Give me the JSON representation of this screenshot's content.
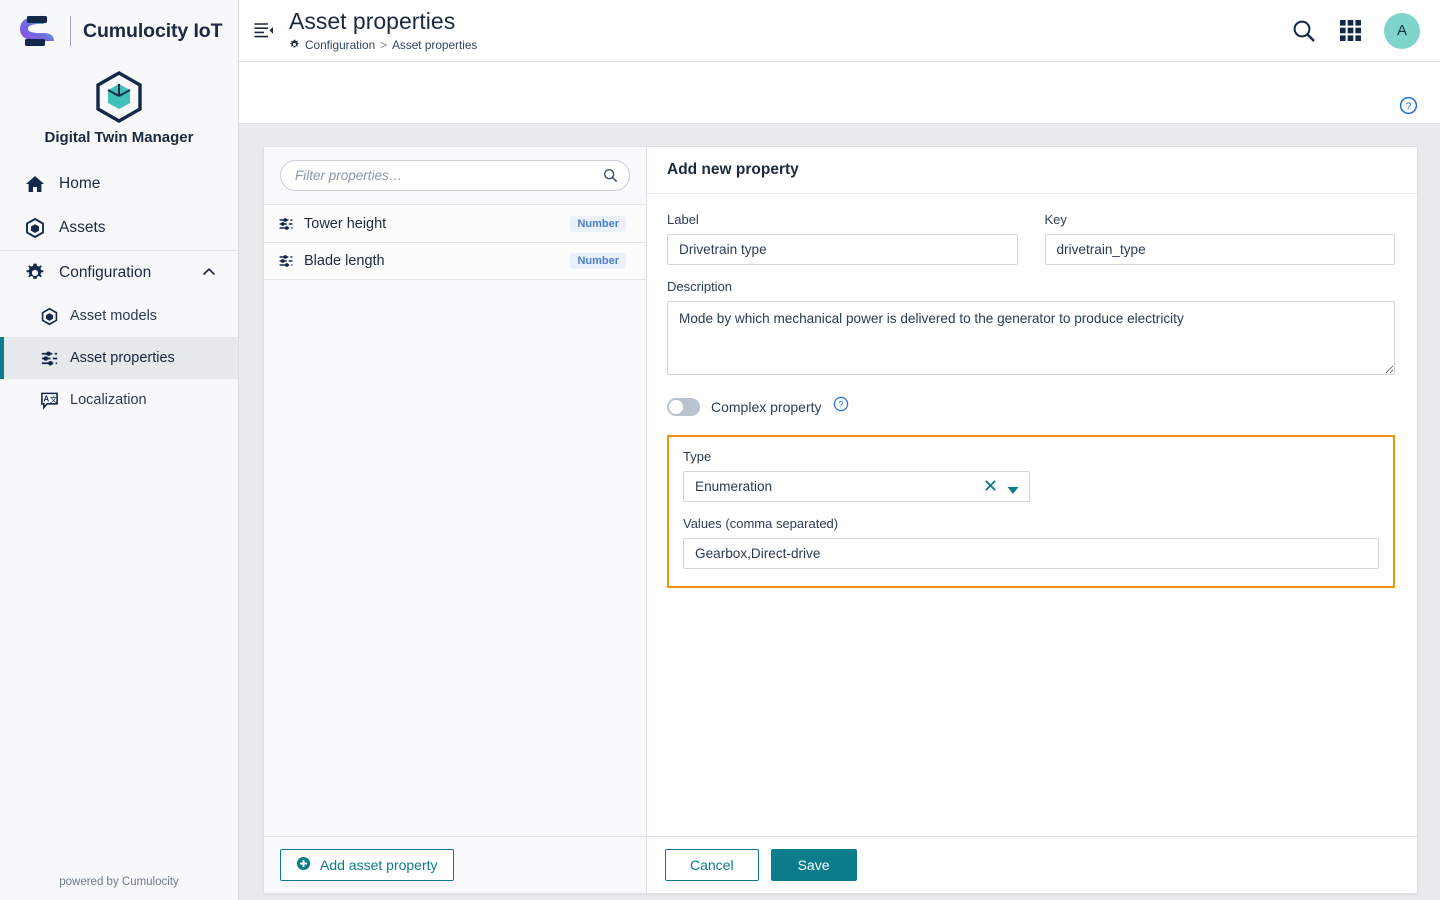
{
  "sidebar": {
    "brand_name": "Cumulocity IoT",
    "brand_logo_icon": "cumulocity-s-logo",
    "app_name": "Digital Twin Manager",
    "app_icon": "cube-hexagon-icon",
    "items": [
      {
        "label": "Home",
        "icon": "home-icon"
      },
      {
        "label": "Assets",
        "icon": "cube-icon"
      },
      {
        "label": "Configuration",
        "icon": "gear-icon",
        "chevron": "chevron-up-icon",
        "expanded": true
      }
    ],
    "sub_items": [
      {
        "label": "Asset models",
        "icon": "cube-icon",
        "active": false
      },
      {
        "label": "Asset properties",
        "icon": "sliders-icon",
        "active": true
      },
      {
        "label": "Localization",
        "icon": "translate-icon",
        "active": false
      }
    ],
    "footer_text": "powered by Cumulocity"
  },
  "topbar": {
    "collapse_icon": "collapse-sidebar-icon",
    "title": "Asset properties",
    "breadcrumb": {
      "icon": "gear-icon",
      "parent": "Configuration",
      "separator": ">",
      "current": "Asset properties"
    },
    "search_icon": "search-icon",
    "apps_icon": "app-grid-icon",
    "avatar_initial": "A",
    "avatar_color": "#7fd4cc"
  },
  "subbar": {
    "help_icon": "help-circle-icon"
  },
  "list_panel": {
    "filter": {
      "placeholder": "Filter properties…",
      "value": "",
      "icon": "search-icon"
    },
    "rows": [
      {
        "icon": "sliders-icon",
        "name": "Tower height",
        "type_badge": "Number"
      },
      {
        "icon": "sliders-icon",
        "name": "Blade length",
        "type_badge": "Number"
      }
    ],
    "add_button": {
      "label": "Add asset property",
      "icon": "plus-circle-icon"
    }
  },
  "form": {
    "heading": "Add new property",
    "label_field": {
      "label": "Label",
      "value": "Drivetrain type"
    },
    "key_field": {
      "label": "Key",
      "value": "drivetrain_type"
    },
    "description_field": {
      "label": "Description",
      "value": "Mode by which mechanical power is delivered to the generator to produce electricity"
    },
    "complex_toggle": {
      "label": "Complex property",
      "state": "off",
      "help_icon": "help-circle-icon"
    },
    "highlight": {
      "border_color": "#f0920f",
      "type_field": {
        "label": "Type",
        "value": "Enumeration",
        "clear_icon": "clear-x-icon",
        "caret_icon": "caret-down-icon"
      },
      "values_field": {
        "label": "Values (comma separated)",
        "value": "Gearbox,Direct-drive"
      }
    },
    "cancel_button": "Cancel",
    "save_button": "Save"
  },
  "theme": {
    "accent_teal": "#0b7c8c",
    "highlight_orange": "#f0920f",
    "badge_blue": "#4a7fd0",
    "navy": "#1b2a3f"
  }
}
